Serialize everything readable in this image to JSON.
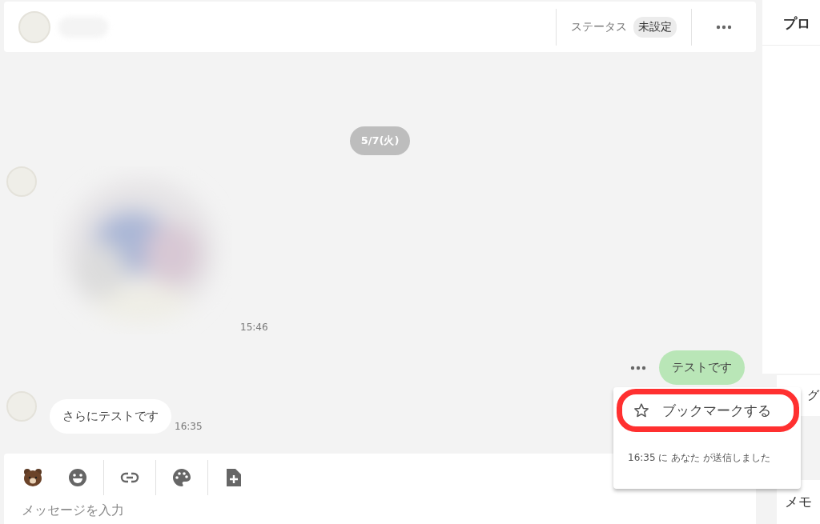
{
  "header": {
    "status_label": "ステータス",
    "status_value": "未設定"
  },
  "date_chip": "5/7(火)",
  "messages": [
    {
      "time": "15:46"
    },
    {
      "kind": "sent",
      "text": "テストです",
      "menu_open": true
    },
    {
      "kind": "received",
      "text": "さらにテストです",
      "time": "16:35"
    }
  ],
  "message_menu": {
    "items": [
      {
        "label": "ブックマークする",
        "highlighted": true
      }
    ],
    "info": "16:35 に あなた が送信しました"
  },
  "composer": {
    "tools": [
      {
        "kind": "sticker"
      },
      {
        "kind": "emoji"
      },
      {
        "kind": "link"
      },
      {
        "kind": "palette"
      },
      {
        "kind": "file"
      }
    ],
    "placeholder": "メッセージを入力"
  },
  "side_panel": {
    "title": "プロ",
    "sections": [
      "グ",
      "メモ"
    ]
  }
}
